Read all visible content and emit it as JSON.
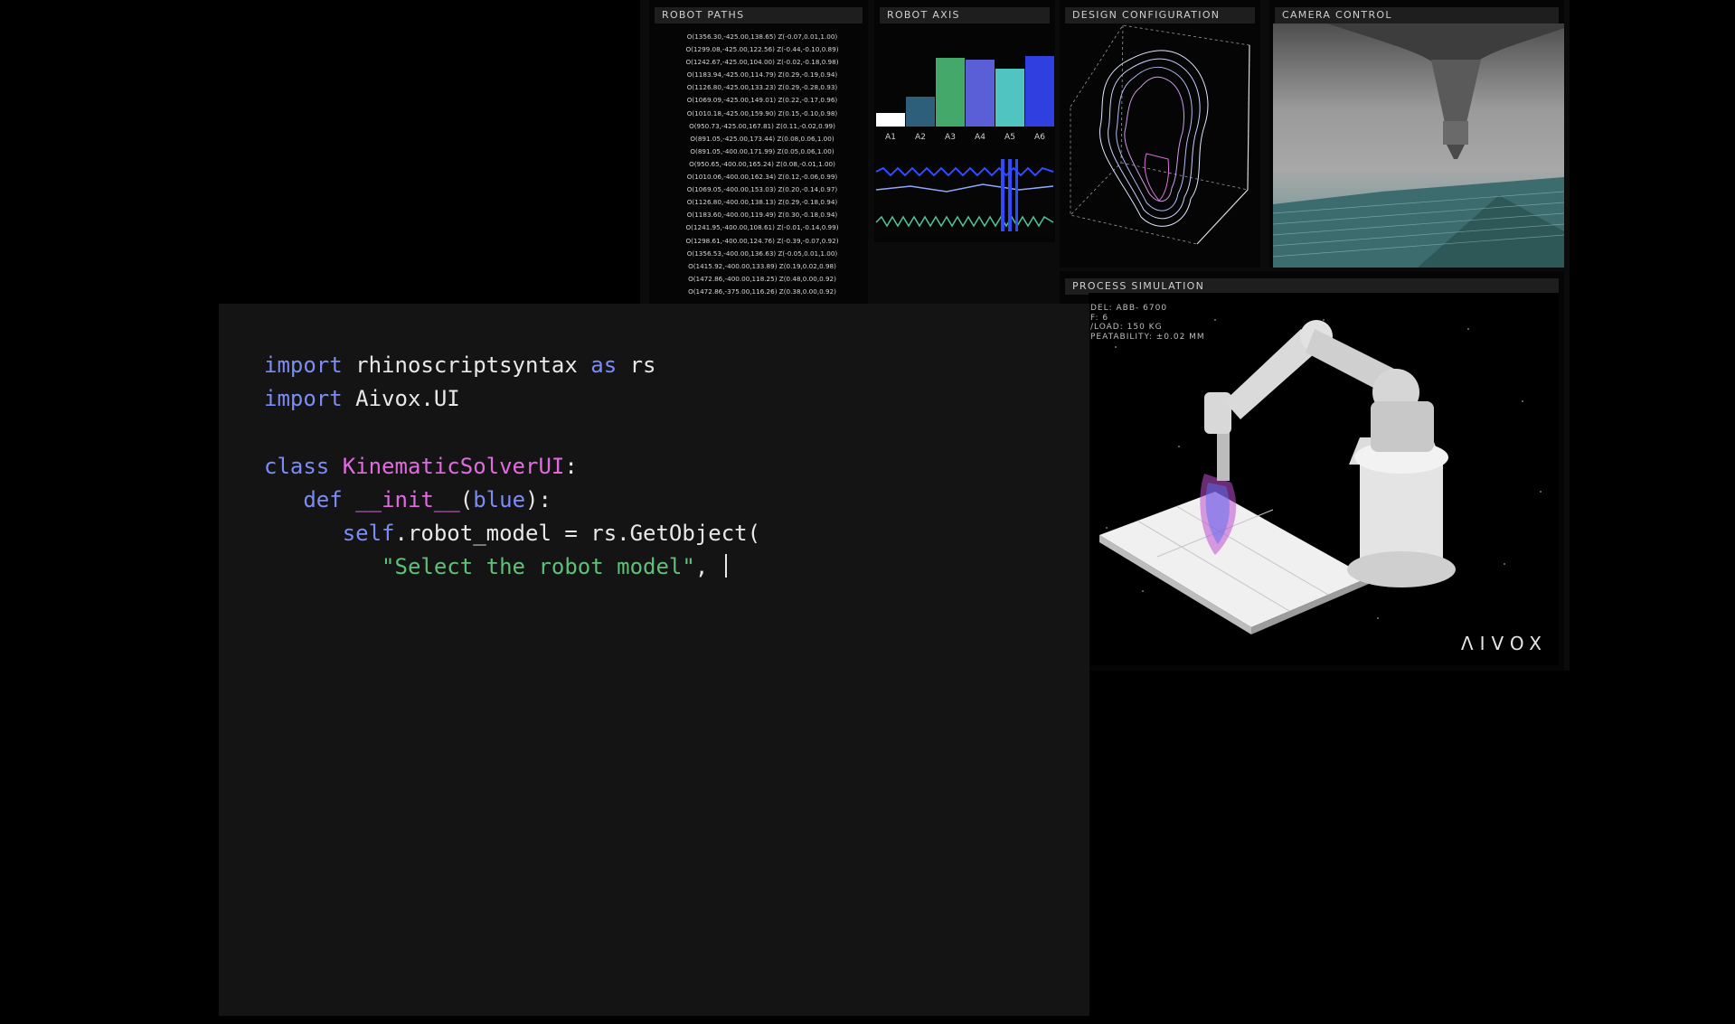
{
  "dashboard": {
    "robot_paths": {
      "title": "ROBOT PATHS",
      "rows": [
        "O(1356.30,-425.00,138.65) Z(-0.07,0.01,1.00)",
        "O(1299.08,-425.00,122.56) Z(-0.44,-0.10,0.89)",
        "O(1242.67,-425.00,104.00) Z(-0.02,-0.18,0.98)",
        "O(1183.94,-425.00,114.79) Z(0.29,-0.19,0.94)",
        "O(1126.80,-425.00,133.23) Z(0.29,-0.28,0.93)",
        "O(1069.09,-425.00,149.01) Z(0.22,-0.17,0.96)",
        "O(1010.18,-425.00,159.90) Z(0.15,-0.10,0.98)",
        "O(950.73,-425.00,167.81) Z(0.11,-0.02,0.99)",
        "O(891.05,-425.00,173.44) Z(0.08,0.06,1.00)",
        "O(891.05,-400.00,171.99) Z(0.05,0.06,1.00)",
        "O(950.65,-400.00,165.24) Z(0.08,-0.01,1.00)",
        "O(1010.06,-400.00,162.34) Z(0.12,-0.06,0.99)",
        "O(1069.05,-400.00,153.03) Z(0.20,-0.14,0.97)",
        "O(1126.80,-400.00,138.13) Z(0.29,-0.18,0.94)",
        "O(1183.60,-400.00,119.49) Z(0.30,-0.18,0.94)",
        "O(1241.95,-400.00,108.61) Z(-0.01,-0.14,0.99)",
        "O(1298.61,-400.00,124.76) Z(-0.39,-0.07,0.92)",
        "O(1356.53,-400.00,136.63) Z(-0.05,0.01,1.00)",
        "O(1415.92,-400.00,133.89) Z(0.19,0.02,0.98)",
        "O(1472.86,-400.00,118.25) Z(0.48,0.00,0.92)",
        "O(1472.86,-375.00,116.26) Z(0.38,0.00,0.92)"
      ]
    },
    "robot_axis": {
      "title": "ROBOT AXIS",
      "axes": [
        "A1",
        "A2",
        "A3",
        "A4",
        "A5",
        "A6"
      ],
      "colors": [
        "#ffffff",
        "#2d5f7a",
        "#45a86b",
        "#5a5fd8",
        "#4fc4c0",
        "#2f3fe0"
      ]
    },
    "design": {
      "title": "DESIGN CONFIGURATION"
    },
    "camera": {
      "title": "CAMERA CONTROL"
    },
    "simulation": {
      "title": "PROCESS SIMULATION",
      "specs": [
        "DEL: ABB- 6700",
        "F: 6",
        "/LOAD: 150 KG",
        "PEATABILITY: ±0.02 MM"
      ],
      "logo": "ΛIVOX"
    }
  },
  "editor": {
    "line1": {
      "kw1": "import",
      "mod": " rhinoscriptsyntax ",
      "kw2": "as",
      "alias": " rs"
    },
    "line2": {
      "kw": "import",
      "mod": " Aivox.UI"
    },
    "line4": {
      "kw": "class",
      "name": "KinematicSolverUI",
      "colon": ":"
    },
    "line5": {
      "kw": "def",
      "fn": "__init__",
      "open": "(",
      "param": "blue",
      "close": "):"
    },
    "line6": {
      "kw": "self",
      "rest": ".robot_model = rs.GetObject("
    },
    "line7": {
      "str": "\"Select the robot model\"",
      "comma": ", "
    }
  }
}
